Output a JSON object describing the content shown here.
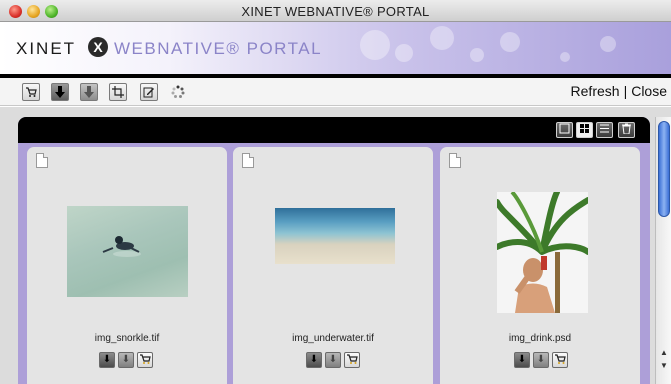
{
  "window": {
    "title": "XINET WEBNATIVE® PORTAL"
  },
  "banner": {
    "brand": "XINET",
    "product": "WEBNATIVE® PORTAL",
    "logo_mark": "X"
  },
  "toolbar": {
    "icons": [
      "cart-icon",
      "download-icon",
      "download-disabled-icon",
      "crop-icon",
      "edit-icon",
      "spinner-icon"
    ],
    "refresh_label": "Refresh",
    "separator": "|",
    "close_label": "Close"
  },
  "panel": {
    "view_buttons": [
      "grid-large-icon",
      "grid-small-icon",
      "list-icon",
      "trash-icon"
    ]
  },
  "cards": [
    {
      "filename": "img_snorkle.tif",
      "actions": [
        "download-icon",
        "download-alt-icon",
        "cart-icon"
      ]
    },
    {
      "filename": "img_underwater.tif",
      "actions": [
        "download-icon",
        "download-alt-icon",
        "cart-icon"
      ]
    },
    {
      "filename": "img_drink.psd",
      "actions": [
        "download-icon",
        "download-alt-icon",
        "cart-icon"
      ]
    }
  ],
  "colors": {
    "accent_purple": "#ad9fd8",
    "scroll_blue": "#3b6fd6",
    "header_black": "#000000"
  }
}
